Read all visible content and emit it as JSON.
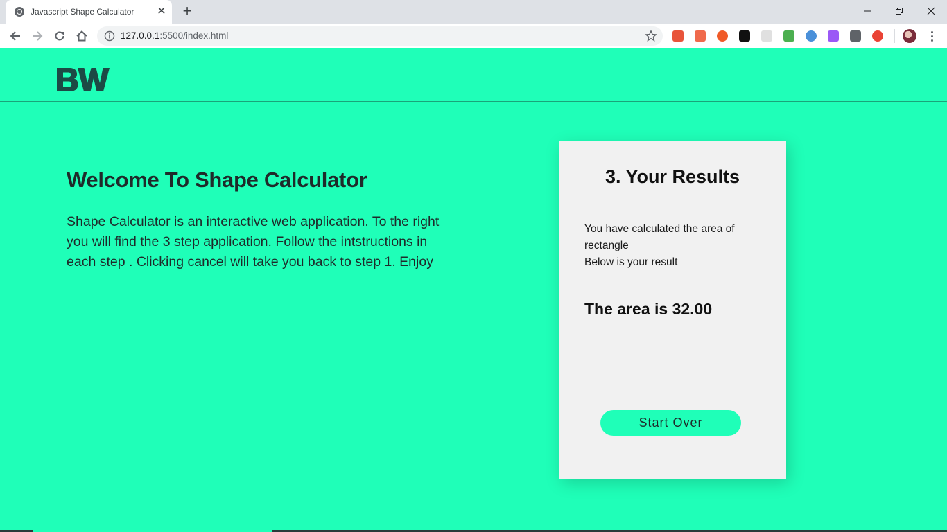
{
  "browser": {
    "tab_title": "Javascript Shape Calculator",
    "url_host": "127.0.0.1",
    "url_rest": ":5500/index.html",
    "extension_icons": [
      "office-extension-icon",
      "streaming-extension-icon",
      "infinity-extension-icon",
      "gnome-extension-icon",
      "blank-extension-icon",
      "color-picker-extension-icon",
      "opera-extension-icon",
      "pen-extension-icon",
      "angular-extension-icon",
      "chrome-rainbow-extension-icon"
    ],
    "extension_colors": [
      "#e8543a",
      "#f06a4c",
      "#f05a28",
      "#111111",
      "#e0e0e0",
      "#4caf50",
      "#4a90d9",
      "#9b59f6",
      "#5f6368",
      "#ea4335"
    ]
  },
  "header": {
    "logo_text": "BW"
  },
  "welcome": {
    "title": "Welcome To Shape Calculator",
    "body": "Shape Calculator is an interactive web application. To the right you will find the 3 step application. Follow the intstructions in each step . Clicking cancel will take you back to step 1. Enjoy"
  },
  "results_card": {
    "title": "3. Your Results",
    "desc_line1": "You have calculated the area of rectangle",
    "desc_line2": "Below is your result",
    "result": "The area is 32.00",
    "start_over_label": "Start Over"
  },
  "colors": {
    "page_background": "#1fffb8",
    "card_background": "#f1f1f1",
    "logo": "#1c4a45",
    "text": "#1f2a2a"
  }
}
